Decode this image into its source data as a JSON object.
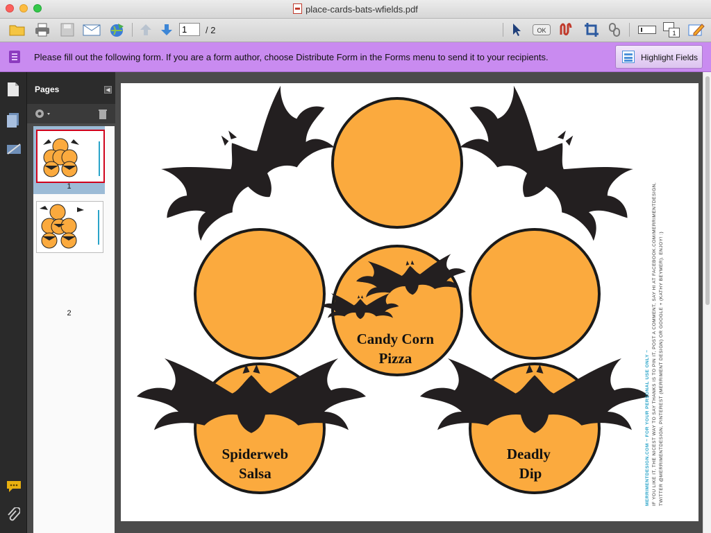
{
  "window": {
    "title": "place-cards-bats-wfields.pdf"
  },
  "toolbar": {
    "page_current": "1",
    "page_total": "/ 2",
    "ok_label": "OK"
  },
  "form_banner": {
    "message": "Please fill out the following form. If you are a form author, choose Distribute Form in the Forms menu to send it to your recipients.",
    "highlight_label": "Highlight Fields"
  },
  "pages_panel": {
    "title": "Pages",
    "thumbnails": [
      {
        "number": "1",
        "selected": true
      },
      {
        "number": "2",
        "selected": false
      }
    ]
  },
  "document": {
    "cards": [
      {
        "line1": "Candy Corn",
        "line2": "Pizza"
      },
      {
        "line1": "Spiderweb",
        "line2": "Salsa"
      },
      {
        "line1": "Deadly",
        "line2": "Dip"
      }
    ],
    "side_text": {
      "line1": "MERRIMENTDESIGN.COM ~ FOR YOUR PERSONAL USE ONLY ~",
      "line2": "IF YOU LIKE IT, THE NICEST WAY TO SAY THANKS IS TO PIN IT, POST A COMMENT, SAY HI AT FACEBOOK.COM/MERRIMENTDESIGN,",
      "line3": "TWITTER @MERRIMENTDESIGN, PINTEREST (MERRIMENT DESIGN) OR GOOGLE + (KATHY BEYMER). ENJOY! :)"
    },
    "colors": {
      "circle_fill": "#fbaa3e",
      "circle_stroke": "#1a1a1a",
      "bat": "#231f20",
      "side_text_accent": "#2aa4c9"
    }
  }
}
